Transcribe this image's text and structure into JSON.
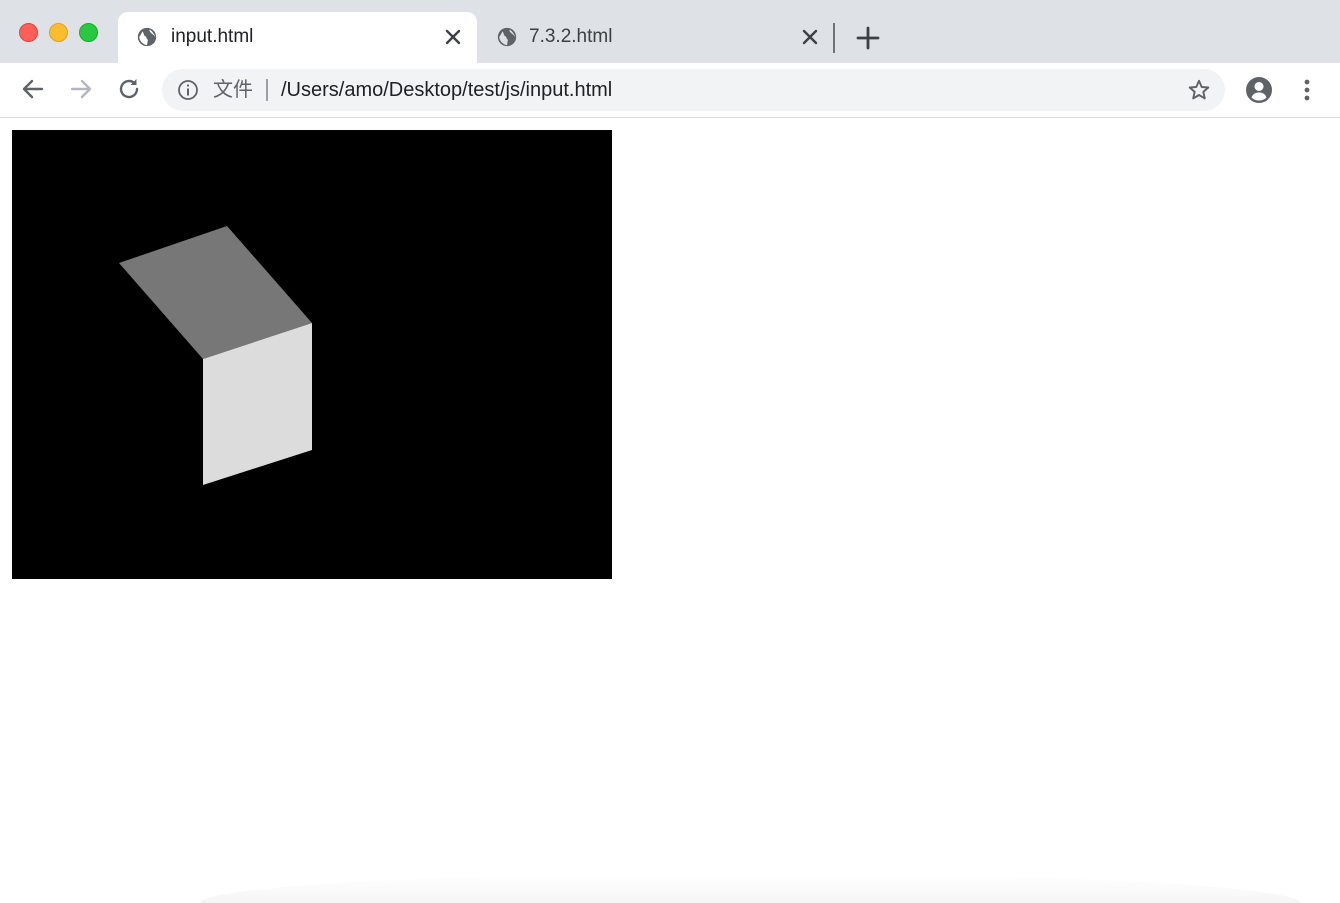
{
  "tabs": [
    {
      "title": "input.html",
      "active": true
    },
    {
      "title": "7.3.2.html",
      "active": false
    }
  ],
  "toolbar": {
    "omnibox_label": "文件",
    "url": "/Users/amo/Desktop/test/js/input.html"
  },
  "icons": {
    "back": "back-arrow-icon",
    "forward": "forward-arrow-icon",
    "reload": "reload-icon",
    "info": "info-icon",
    "star": "star-icon",
    "profile": "profile-icon",
    "menu": "kebab-menu-icon",
    "new_tab": "plus-icon",
    "tab_close": "close-icon",
    "tab_favicon": "globe-icon"
  },
  "colors": {
    "canvas_background": "#000000",
    "cube_top_face": "#777777",
    "cube_front_face": "#dcdcdc",
    "tabstrip": "#dee1e6",
    "omnibox": "#f1f3f4"
  }
}
